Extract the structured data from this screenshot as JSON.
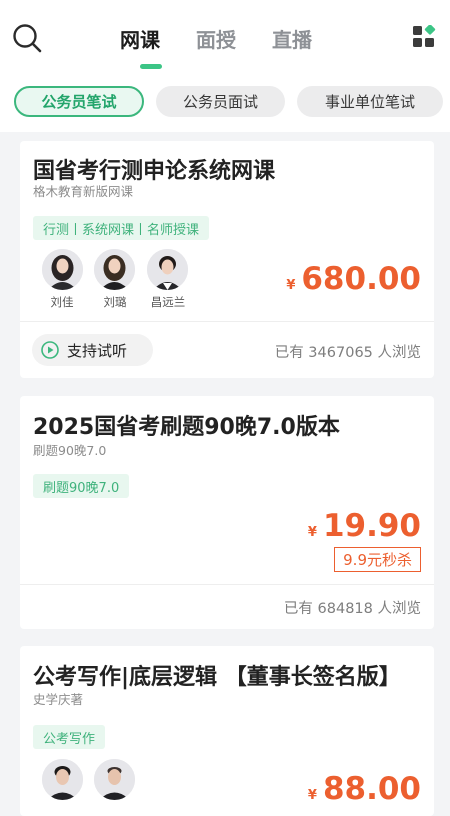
{
  "header": {
    "tabs": [
      {
        "label": "网课"
      },
      {
        "label": "面授"
      },
      {
        "label": "直播"
      }
    ]
  },
  "filters": [
    {
      "label": "公务员笔试"
    },
    {
      "label": "公务员面试"
    },
    {
      "label": "事业单位笔试"
    }
  ],
  "colors": {
    "accent": "#3cc586",
    "price": "#ec5f2f"
  },
  "courses": [
    {
      "title": "国省考行测申论系统网课",
      "subtitle": "格木教育新版网课",
      "tag": "行测丨系统网课丨名师授课",
      "teachers": [
        {
          "name": "刘佳"
        },
        {
          "name": "刘璐"
        },
        {
          "name": "昌远兰"
        }
      ],
      "currency": "¥",
      "price": "680.00",
      "trial_label": "支持试听",
      "views": "已有 3467065 人浏览"
    },
    {
      "title": "2025国省考刷题90晚7.0版本",
      "subtitle": "刷题90晚7.0",
      "tag": "刷题90晚7.0",
      "currency": "¥",
      "price": "19.90",
      "sale_label": "9.9元秒杀",
      "views": "已有 684818 人浏览"
    },
    {
      "title": "公考写作|底层逻辑 【董事长签名版】",
      "subtitle": "史学庆著",
      "tag": "公考写作",
      "currency": "¥",
      "price": "88.00"
    }
  ]
}
